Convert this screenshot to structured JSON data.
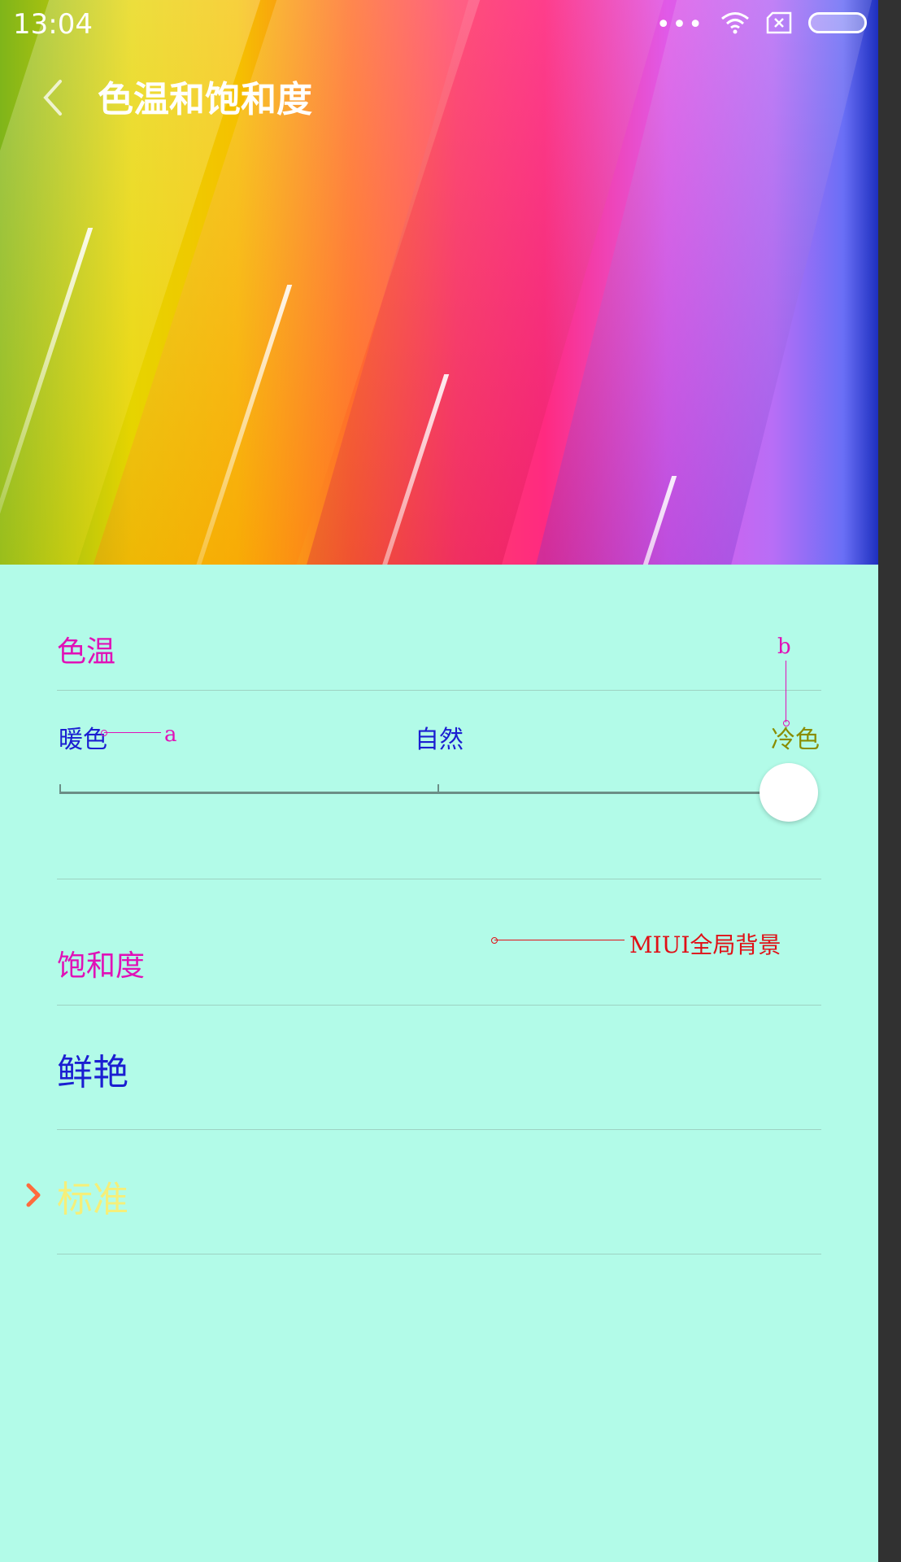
{
  "status_bar": {
    "time": "13:04",
    "dots": "•••",
    "icons": [
      "wifi-icon",
      "no-sim-icon",
      "battery-icon"
    ]
  },
  "header": {
    "title": "色温和饱和度",
    "back_icon": "back-arrow-icon"
  },
  "color_temperature": {
    "section_title": "色温",
    "labels": {
      "warm": "暖色",
      "natural": "自然",
      "cool": "冷色"
    },
    "slider_position": "cool"
  },
  "annotations": {
    "a": "a",
    "b": "b",
    "bg": "MIUI全局背景"
  },
  "saturation": {
    "section_title": "饱和度",
    "options": [
      {
        "label": "鲜艳",
        "selected": false
      },
      {
        "label": "标准",
        "selected": true
      }
    ]
  },
  "colors": {
    "background": "#b2fbe8",
    "accent": "#e011b7",
    "label_blue": "#1b1ed1",
    "selected_text": "#f5ef7a",
    "chevron": "#ff6b3d"
  }
}
